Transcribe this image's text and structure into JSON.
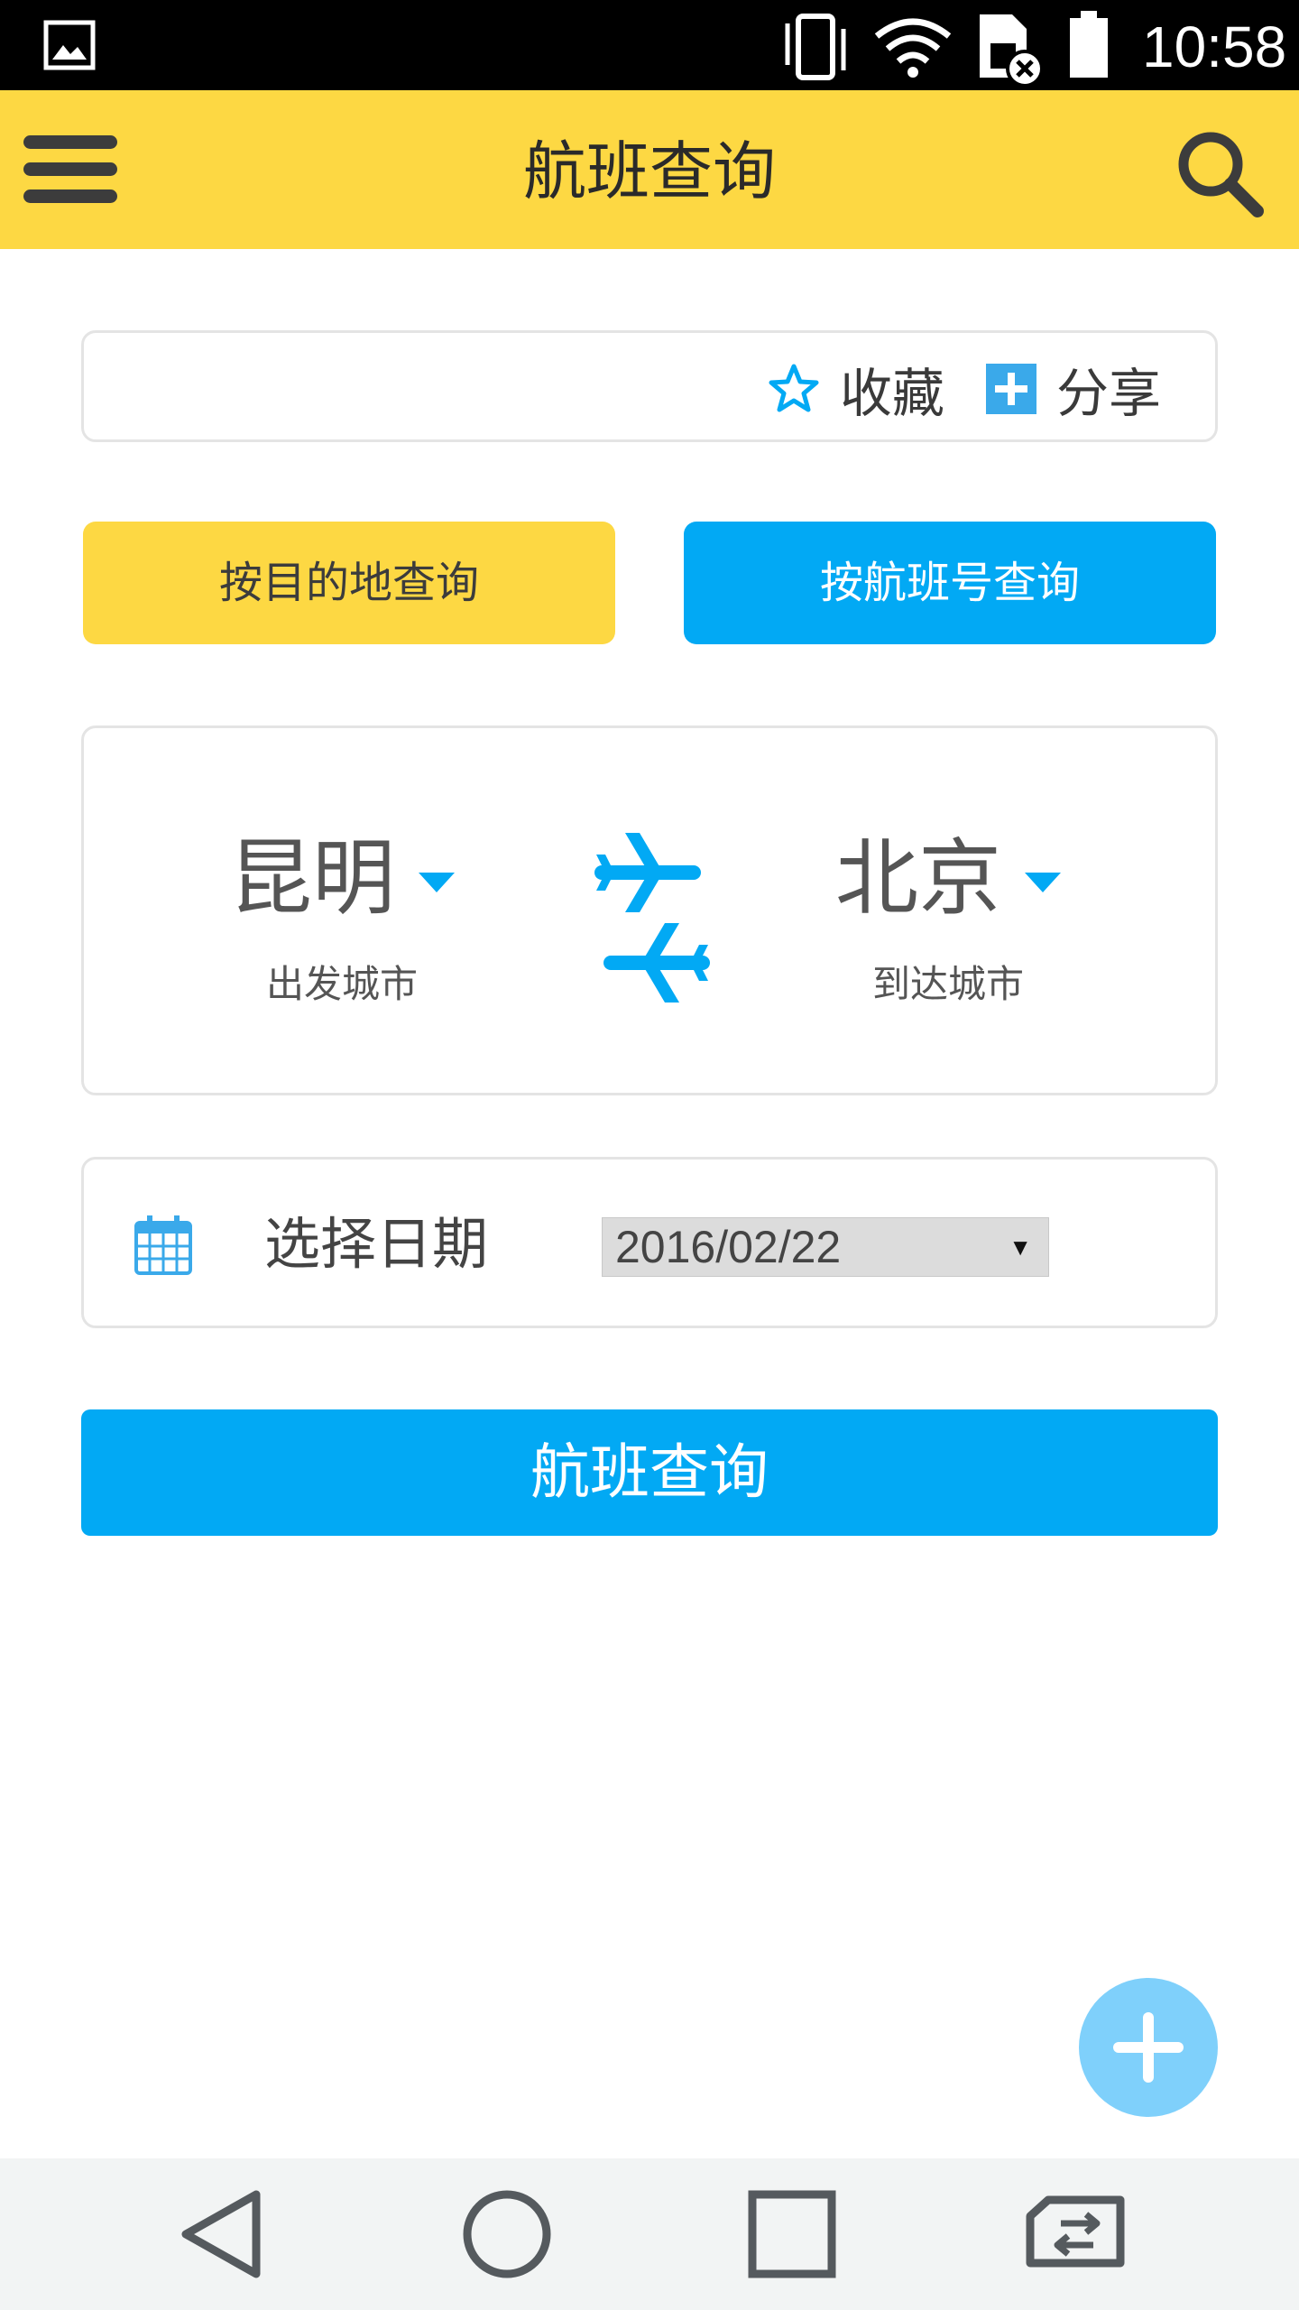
{
  "status_bar": {
    "time": "10:58",
    "icons": [
      "gallery-icon",
      "vibrate-icon",
      "wifi-icon",
      "sim-error-icon",
      "battery-icon"
    ]
  },
  "app_bar": {
    "title": "航班查询",
    "menu_icon": "hamburger-menu-icon",
    "search_icon": "search-icon",
    "background_color": "#fdd843"
  },
  "actions": {
    "favorite_label": "收藏",
    "share_label": "分享"
  },
  "mode_tabs": {
    "by_destination": "按目的地查询",
    "by_flight_number": "按航班号查询"
  },
  "route": {
    "departure_city": "昆明",
    "departure_label": "出发城市",
    "arrival_city": "北京",
    "arrival_label": "到达城市",
    "swap_icon": "swap-flights-icon"
  },
  "date": {
    "label": "选择日期",
    "selected_value": "2016/02/22",
    "icon": "calendar-icon"
  },
  "submit_label": "航班查询",
  "fab_icon": "plus-icon",
  "nav_bar": {
    "icons": [
      "back-icon",
      "home-icon",
      "recent-apps-icon",
      "switch-sim-icon"
    ]
  },
  "colors": {
    "accent_blue": "#02a9f4",
    "accent_yellow": "#fdd843",
    "fab": "#7fd0fb"
  }
}
